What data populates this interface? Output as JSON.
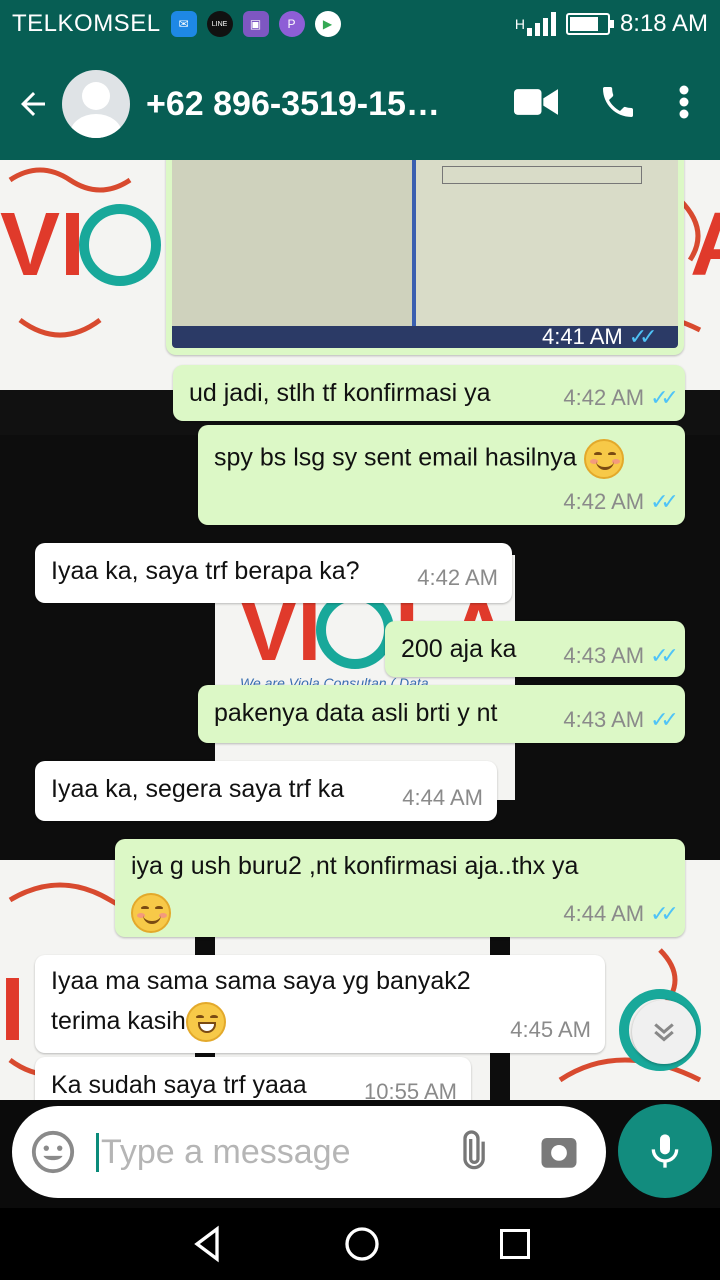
{
  "status_bar": {
    "carrier": "TELKOMSEL",
    "network": "H",
    "time": "8:18 AM",
    "battery_level": 0.8
  },
  "header": {
    "contact": "+62 896-3519-15…",
    "icons": [
      "back-arrow-icon",
      "avatar",
      "video-call-icon",
      "phone-icon",
      "more-vert-icon"
    ]
  },
  "messages": [
    {
      "dir": "out",
      "text": "",
      "time": "4:41 AM",
      "type": "image"
    },
    {
      "dir": "out",
      "text": "ud jadi, stlh tf konfirmasi ya",
      "time": "4:42 AM"
    },
    {
      "dir": "out",
      "text": "spy bs lsg sy sent email hasilnya",
      "time": "4:42 AM"
    },
    {
      "dir": "in",
      "text": "Iyaa ka, saya trf berapa ka?",
      "time": "4:42 AM"
    },
    {
      "dir": "out",
      "text": "200 aja ka",
      "time": "4:43 AM"
    },
    {
      "dir": "out",
      "text": "pakenya data asli brti y nt",
      "time": "4:43 AM"
    },
    {
      "dir": "in",
      "text": "Iyaa ka, segera saya trf ka",
      "time": "4:44 AM"
    },
    {
      "dir": "out",
      "text": "iya g ush buru2 ,nt konfirmasi aja..thx ya",
      "time": "4:44 AM"
    },
    {
      "dir": "in",
      "text": "Iyaa ma sama sama saya yg banyak2",
      "text2": "terima kasih",
      "time": "4:45 AM"
    },
    {
      "dir": "in",
      "text": "Ka sudah saya trf yaaa",
      "time": "10:55 AM"
    }
  ],
  "wallpaper": {
    "brand": "VIOLA",
    "brand_prefix": "VI",
    "brand_suffix": "LA",
    "tagline": "We are Viola Consultan ( Data"
  },
  "composer": {
    "placeholder": "Type a message"
  },
  "colors": {
    "header": "#075e54",
    "outgoing": "#dcf8c6",
    "incoming": "#ffffff",
    "ticks": "#4fc3f7",
    "mic": "#128c7e"
  }
}
